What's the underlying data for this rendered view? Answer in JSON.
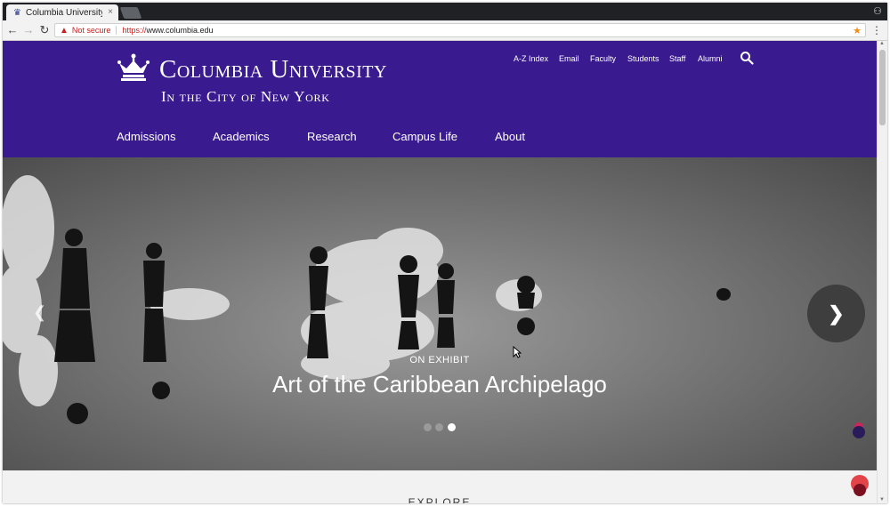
{
  "browser": {
    "tab_title": "Columbia University",
    "tab_close": "×",
    "not_secure": "Not secure",
    "url_scheme": "https://",
    "url_host": "www.columbia.edu"
  },
  "header": {
    "name": "Columbia University",
    "subtitle": "In the City of New York",
    "utility_links": [
      "A-Z Index",
      "Email",
      "Faculty",
      "Students",
      "Staff",
      "Alumni"
    ],
    "nav": [
      "Admissions",
      "Academics",
      "Research",
      "Campus Life",
      "About"
    ]
  },
  "hero": {
    "eyebrow": "ON EXHIBIT",
    "headline": "Art of the Caribbean Archipelago",
    "slides_total": 3,
    "active_slide": 3
  },
  "below": {
    "section_title": "EXPLORE"
  },
  "colors": {
    "brand_purple": "#3a1b8f",
    "chrome_dark": "#202124",
    "warning_red": "#c5221f",
    "fab_red": "#e2444a"
  },
  "icons": [
    "crown-logo-icon",
    "search-icon",
    "back-arrow-icon",
    "forward-arrow-icon",
    "reload-icon",
    "warning-icon",
    "star-icon",
    "menu-icon",
    "chevron-left-icon",
    "chevron-right-icon",
    "incognito-icon"
  ]
}
